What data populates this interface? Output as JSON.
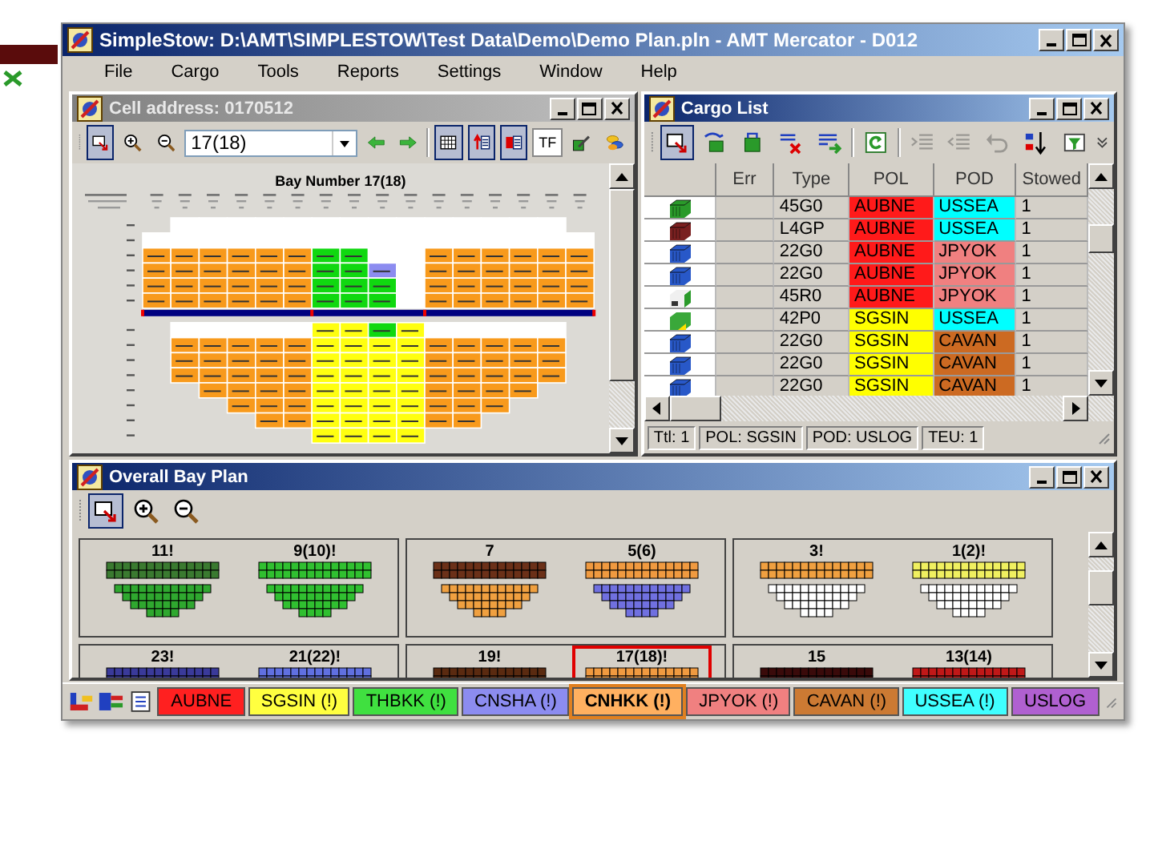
{
  "window": {
    "title": "SimpleStow: D:\\AMT\\SIMPLESTOW\\Test Data\\Demo\\Demo Plan.pln - AMT Mercator - D012"
  },
  "menu": [
    "File",
    "Cargo",
    "Tools",
    "Reports",
    "Settings",
    "Window",
    "Help"
  ],
  "cell_panel": {
    "title": "Cell address: 0170512",
    "active": false,
    "toolbar": [
      {
        "kind": "select",
        "pressed": true
      },
      {
        "kind": "zoom_in",
        "pressed": false
      },
      {
        "kind": "zoom_out",
        "pressed": false
      },
      {
        "kind": "combo",
        "value": "17(18)"
      },
      {
        "kind": "arrow_left",
        "pressed": false
      },
      {
        "kind": "arrow_right",
        "pressed": false
      },
      {
        "kind": "separator"
      },
      {
        "kind": "grid",
        "pressed": true
      },
      {
        "kind": "list_up",
        "pressed": true
      },
      {
        "kind": "list_red",
        "pressed": true
      },
      {
        "kind": "text",
        "label": "TF",
        "pressed": false
      },
      {
        "kind": "pencil",
        "pressed": false
      },
      {
        "kind": "coins",
        "pressed": false
      }
    ],
    "bay_title": "Bay Number 17(18)"
  },
  "cargo_list": {
    "title": "Cargo List",
    "active": true,
    "toolbar": [
      {
        "kind": "select",
        "pressed": true,
        "disabled": false
      },
      {
        "kind": "container_arrow",
        "pressed": false,
        "disabled": false
      },
      {
        "kind": "container_load",
        "pressed": false,
        "disabled": false
      },
      {
        "kind": "remove",
        "pressed": false,
        "disabled": false
      },
      {
        "kind": "list_add",
        "pressed": false,
        "disabled": false
      },
      {
        "kind": "separator"
      },
      {
        "kind": "refresh",
        "pressed": false,
        "disabled": false
      },
      {
        "kind": "separator"
      },
      {
        "kind": "indent",
        "pressed": false,
        "disabled": true
      },
      {
        "kind": "outdent",
        "pressed": false,
        "disabled": true
      },
      {
        "kind": "undo",
        "pressed": false,
        "disabled": true
      },
      {
        "kind": "sort",
        "pressed": false,
        "disabled": false
      },
      {
        "kind": "filter",
        "pressed": false,
        "disabled": false
      }
    ],
    "columns": [
      "Err",
      "Type",
      "POL",
      "POD",
      "Stowed"
    ],
    "rows": [
      {
        "icon": {
          "kind": "box",
          "color": "#2a9a2a"
        },
        "type": "45G0",
        "pol": {
          "text": "AUBNE",
          "color": "#ff1a1a"
        },
        "pod": {
          "text": "USSEA",
          "color": "#00ffff"
        },
        "stowed": "1"
      },
      {
        "icon": {
          "kind": "box",
          "color": "#7a2020"
        },
        "type": "L4GP",
        "pol": {
          "text": "AUBNE",
          "color": "#ff1a1a"
        },
        "pod": {
          "text": "USSEA",
          "color": "#00ffff"
        },
        "stowed": "1"
      },
      {
        "icon": {
          "kind": "box",
          "color": "#2858c8"
        },
        "type": "22G0",
        "pol": {
          "text": "AUBNE",
          "color": "#ff1a1a"
        },
        "pod": {
          "text": "JPYOK",
          "color": "#f08080"
        },
        "stowed": "1"
      },
      {
        "icon": {
          "kind": "box",
          "color": "#2858c8"
        },
        "type": "22G0",
        "pol": {
          "text": "AUBNE",
          "color": "#ff1a1a"
        },
        "pod": {
          "text": "JPYOK",
          "color": "#f08080"
        },
        "stowed": "1"
      },
      {
        "icon": {
          "kind": "reefer",
          "color": "#f0f0f0"
        },
        "type": "45R0",
        "pol": {
          "text": "AUBNE",
          "color": "#ff1a1a"
        },
        "pod": {
          "text": "JPYOK",
          "color": "#f08080"
        },
        "stowed": "1"
      },
      {
        "icon": {
          "kind": "box_arrow",
          "color": "#3aa83a"
        },
        "type": "42P0",
        "pol": {
          "text": "SGSIN",
          "color": "#ffff00"
        },
        "pod": {
          "text": "USSEA",
          "color": "#00ffff"
        },
        "stowed": "1"
      },
      {
        "icon": {
          "kind": "box",
          "color": "#2858c8"
        },
        "type": "22G0",
        "pol": {
          "text": "SGSIN",
          "color": "#ffff00"
        },
        "pod": {
          "text": "CAVAN",
          "color": "#cc6a22"
        },
        "stowed": "1"
      },
      {
        "icon": {
          "kind": "box",
          "color": "#2858c8"
        },
        "type": "22G0",
        "pol": {
          "text": "SGSIN",
          "color": "#ffff00"
        },
        "pod": {
          "text": "CAVAN",
          "color": "#cc6a22"
        },
        "stowed": "1"
      },
      {
        "icon": {
          "kind": "box",
          "color": "#2858c8"
        },
        "type": "22G0",
        "pol": {
          "text": "SGSIN",
          "color": "#ffff00"
        },
        "pod": {
          "text": "CAVAN",
          "color": "#cc6a22"
        },
        "stowed": "1"
      }
    ],
    "status": [
      "Ttl: 1",
      "POL: SGSIN",
      "POD: USLOG",
      "TEU: 1"
    ]
  },
  "bay_plan": {
    "title": "Overall Bay Plan",
    "active": true,
    "toolbar": [
      {
        "kind": "select",
        "pressed": true
      },
      {
        "kind": "zoom_in",
        "pressed": false
      },
      {
        "kind": "zoom_out",
        "pressed": false
      }
    ],
    "groups": [
      {
        "bays": [
          {
            "label": "11!",
            "color": "#3a7a30",
            "hold": {
              "color": "#2fa82f"
            },
            "selected": false
          },
          {
            "label": "9(10)!",
            "color": "#30c030",
            "hold": {
              "color": "#30c030"
            },
            "selected": false
          }
        ]
      },
      {
        "bays": [
          {
            "label": "7",
            "color": "#6b3018",
            "hold": {
              "color": "#f0a040"
            },
            "selected": false
          },
          {
            "label": "5(6)",
            "color": "#f09a40",
            "hold": {
              "color": "#7070e0"
            },
            "selected": false
          }
        ]
      },
      {
        "bays": [
          {
            "label": "3!",
            "color": "#f0a040",
            "hold": {
              "color": "#ffffff"
            },
            "selected": false
          },
          {
            "label": "1(2)!",
            "color": "#f0f060",
            "hold": {
              "color": "#ffffff"
            },
            "selected": false
          }
        ]
      },
      {
        "bays": [
          {
            "label": "23!",
            "color": "#3a3a9a",
            "selected": false
          },
          {
            "label": "21(22)!",
            "color": "#6070e0",
            "selected": false
          }
        ]
      },
      {
        "bays": [
          {
            "label": "19!",
            "color": "#5a2a10",
            "selected": false
          },
          {
            "label": "17(18)!",
            "color": "#f09a40",
            "selected": true
          }
        ]
      },
      {
        "bays": [
          {
            "label": "15",
            "color": "#3a0a0a",
            "selected": false
          },
          {
            "label": "13(14)",
            "color": "#c01818",
            "selected": false
          }
        ]
      }
    ]
  },
  "legend": [
    {
      "text": "AUBNE",
      "color": "#ff2020",
      "selected": false
    },
    {
      "text": "SGSIN (!)",
      "color": "#ffff40",
      "selected": false
    },
    {
      "text": "THBKK (!)",
      "color": "#40e040",
      "selected": false
    },
    {
      "text": "CNSHA (!)",
      "color": "#8c8cf0",
      "selected": false
    },
    {
      "text": "CNHKK (!)",
      "color": "#ffb060",
      "selected": true
    },
    {
      "text": "JPYOK (!)",
      "color": "#f08080",
      "selected": false
    },
    {
      "text": "CAVAN (!)",
      "color": "#cc7a33",
      "selected": false
    },
    {
      "text": "USSEA (!)",
      "color": "#40ffff",
      "selected": false
    },
    {
      "text": "USLOG",
      "color": "#b060d0",
      "selected": false
    }
  ]
}
